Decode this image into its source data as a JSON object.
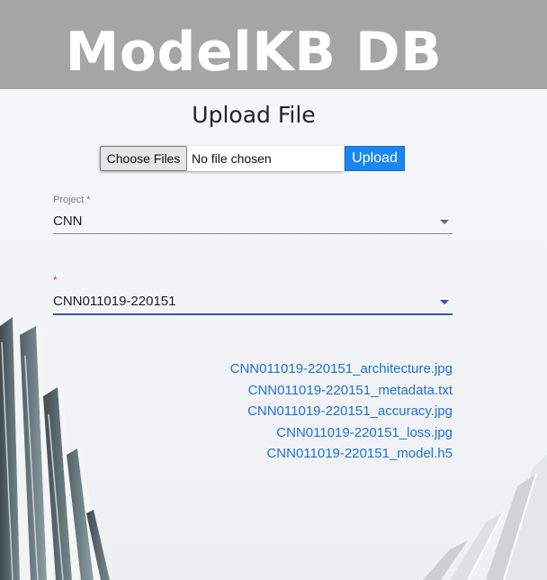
{
  "banner": {
    "title": "ModelKB DB"
  },
  "upload": {
    "title": "Upload File",
    "choose_label": "Choose Files",
    "file_status": "No file chosen",
    "upload_label": "Upload"
  },
  "project_select": {
    "label": "Project *",
    "value": "CNN"
  },
  "model_select": {
    "label": "*",
    "value": "CNN011019-220151"
  },
  "files": [
    "CNN011019-220151_architecture.jpg",
    "CNN011019-220151_metadata.txt",
    "CNN011019-220151_accuracy.jpg",
    "CNN011019-220151_loss.jpg",
    "CNN011019-220151_model.h5"
  ],
  "colors": {
    "banner": "#a5a5a5",
    "upload_button": "#1b86f0",
    "link": "#1e73d2",
    "active_underline": "#3f51b5",
    "required_asterisk": "#e53a55"
  }
}
